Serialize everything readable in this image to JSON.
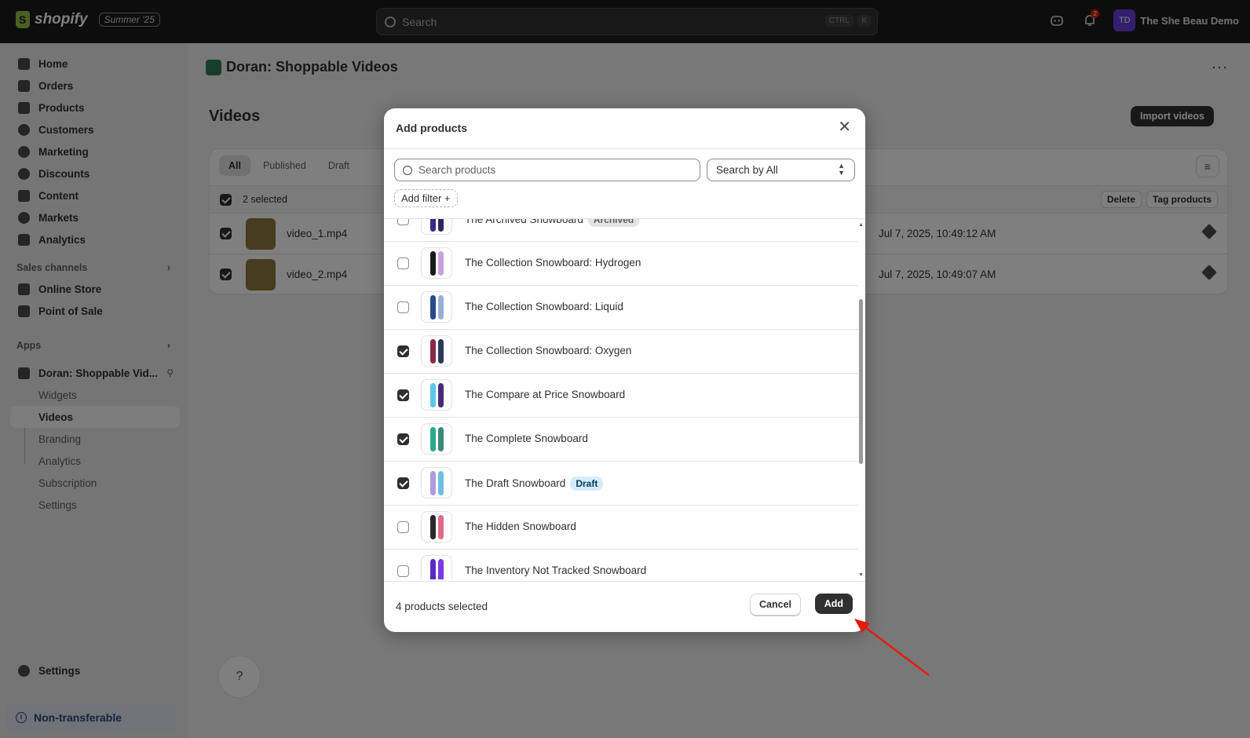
{
  "topbar": {
    "brand": "shopify",
    "edition": "Summer '25",
    "search_placeholder": "Search",
    "kbd_ctrl": "CTRL",
    "kbd_k": "K",
    "notifications_count": "2",
    "avatar_initials": "TD",
    "store_name": "The She Beau Demo"
  },
  "sidebar": {
    "items": [
      {
        "label": "Home"
      },
      {
        "label": "Orders"
      },
      {
        "label": "Products"
      },
      {
        "label": "Customers"
      },
      {
        "label": "Marketing"
      },
      {
        "label": "Discounts"
      },
      {
        "label": "Content"
      },
      {
        "label": "Markets"
      },
      {
        "label": "Analytics"
      }
    ],
    "sales_channels_label": "Sales channels",
    "sales_channels": [
      {
        "label": "Online Store"
      },
      {
        "label": "Point of Sale"
      }
    ],
    "apps_label": "Apps",
    "app_name": "Doran: Shoppable Vid...",
    "app_subitems": [
      {
        "label": "Widgets"
      },
      {
        "label": "Videos"
      },
      {
        "label": "Branding"
      },
      {
        "label": "Analytics"
      },
      {
        "label": "Subscription"
      },
      {
        "label": "Settings"
      }
    ],
    "settings_label": "Settings",
    "non_transferable": "Non-transferable"
  },
  "main": {
    "app_title": "Doran: Shoppable Videos",
    "more": "···",
    "page_title": "Videos",
    "import_label": "Import videos",
    "tabs": [
      {
        "label": "All"
      },
      {
        "label": "Published"
      },
      {
        "label": "Draft"
      }
    ],
    "selected_text": "2 selected",
    "delete_label": "Delete",
    "tag_products_label": "Tag products",
    "videos": [
      {
        "name": "video_1.mp4",
        "date": "Jul 7, 2025, 10:49:12 AM"
      },
      {
        "name": "video_2.mp4",
        "date": "Jul 7, 2025, 10:49:07 AM"
      }
    ],
    "help": "?"
  },
  "modal": {
    "title": "Add products",
    "search_placeholder": "Search products",
    "search_by": "Search by All",
    "add_filter": "Add filter +",
    "products": [
      {
        "name": "The Archived Snowboard",
        "badge": "Archived",
        "checked": false
      },
      {
        "name": "The Collection Snowboard: Hydrogen",
        "badge": "",
        "checked": false
      },
      {
        "name": "The Collection Snowboard: Liquid",
        "badge": "",
        "checked": false
      },
      {
        "name": "The Collection Snowboard: Oxygen",
        "badge": "",
        "checked": true
      },
      {
        "name": "The Compare at Price Snowboard",
        "badge": "",
        "checked": true
      },
      {
        "name": "The Complete Snowboard",
        "badge": "",
        "checked": true
      },
      {
        "name": "The Draft Snowboard",
        "badge": "Draft",
        "checked": true
      },
      {
        "name": "The Hidden Snowboard",
        "badge": "",
        "checked": false
      },
      {
        "name": "The Inventory Not Tracked Snowboard",
        "badge": "",
        "checked": false
      }
    ],
    "selected_count": "4 products selected",
    "cancel_label": "Cancel",
    "add_label": "Add"
  },
  "colors": {
    "topbar_bg": "#1a1a1a",
    "primary_button": "#303030",
    "draft_badge_bg": "#d5ebff",
    "annotation_arrow": "#e51c00"
  }
}
